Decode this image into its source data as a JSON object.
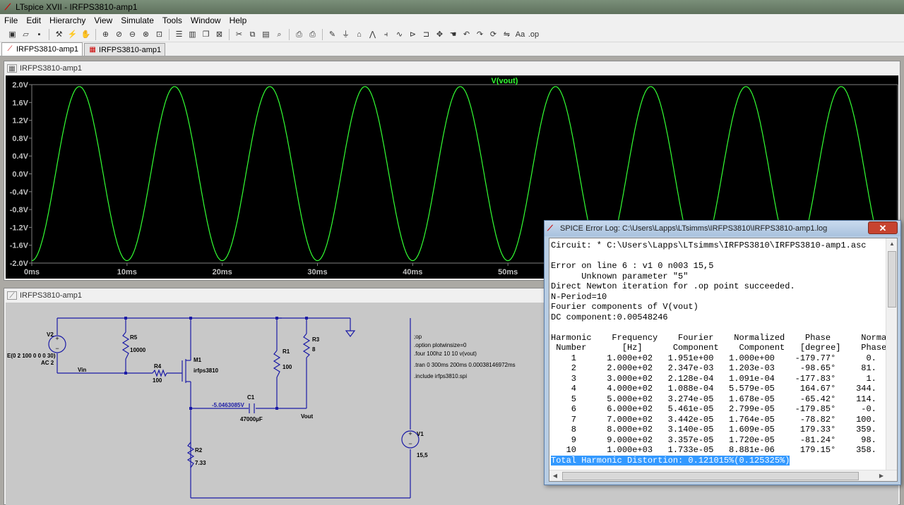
{
  "window": {
    "title": "LTspice XVII - IRFPS3810-amp1",
    "icon": "ltspice-logo-icon"
  },
  "menu": [
    "File",
    "Edit",
    "Hierarchy",
    "View",
    "Simulate",
    "Tools",
    "Window",
    "Help"
  ],
  "toolbar": {
    "icons": [
      "new-schematic-icon",
      "open-icon",
      "save-icon",
      "control-panel-icon",
      "run-icon",
      "halt-icon",
      "zoom-in-icon",
      "pan-icon",
      "zoom-out-icon",
      "zoom-full-icon",
      "autorange-icon",
      "tile-horizontal-icon",
      "tile-vertical-icon",
      "cascade-icon",
      "close-window-icon",
      "cut-icon",
      "copy-icon",
      "paste-icon",
      "find-icon",
      "print-setup-icon",
      "print-icon",
      "wire-icon",
      "ground-icon",
      "label-icon",
      "resistor-icon",
      "capacitor-icon",
      "inductor-icon",
      "diode-icon",
      "component-icon",
      "move-icon",
      "drag-icon",
      "undo-icon",
      "redo-icon",
      "rotate-icon",
      "mirror-icon",
      "text-icon",
      "spice-directive-icon"
    ]
  },
  "tabs": [
    {
      "label": "IRFPS3810-amp1",
      "icon": "schematic-icon",
      "active": true
    },
    {
      "label": "IRFPS3810-amp1",
      "icon": "waveform-icon",
      "active": false
    }
  ],
  "wave_pane": {
    "title": "IRFPS3810-amp1"
  },
  "chart_data": {
    "type": "line",
    "title": "V(vout)",
    "xlabel": "",
    "ylabel": "",
    "xlim": [
      0,
      91
    ],
    "ylim": [
      -2.0,
      2.0
    ],
    "x_ticks": [
      "0ms",
      "10ms",
      "20ms",
      "30ms",
      "40ms",
      "50ms"
    ],
    "x_tick_values": [
      0,
      10,
      20,
      30,
      40,
      50
    ],
    "y_ticks": [
      "2.0V",
      "1.6V",
      "1.2V",
      "0.8V",
      "0.4V",
      "0.0V",
      "-0.4V",
      "-0.8V",
      "-1.2V",
      "-1.6V",
      "-2.0V"
    ],
    "y_tick_values": [
      2.0,
      1.6,
      1.2,
      0.8,
      0.4,
      0.0,
      -0.4,
      -0.8,
      -1.2,
      -1.6,
      -2.0
    ],
    "series": [
      {
        "name": "V(vout)",
        "color": "#33ff33",
        "frequency_hz": 100,
        "amplitude": 1.951,
        "offset": 0.00548246,
        "phase_deg": -179.77
      }
    ],
    "grid": false,
    "background": "#000000"
  },
  "sch_pane": {
    "title": "IRFPS3810-amp1",
    "labels": {
      "v2": "V2",
      "v2_value1": "E(0 2 100 0 0 0 30)",
      "v2_value2": "AC 2",
      "r5": "R5",
      "r5_value": "10000",
      "vin": "Vin",
      "r4": "R4",
      "r4_value": "100",
      "m1": "M1",
      "m1_value": "irfps3810",
      "r1": "R1",
      "r1_value": "100",
      "r3": "R3",
      "r3_value": "8",
      "c1": "C1",
      "c1_value": "47000µF",
      "node_voltage": "-5.0463085V",
      "vout": "Vout",
      "r2": "R2",
      "r2_value": "7.33",
      "v1": "V1",
      "v1_value": "15,5",
      "dir_op": ";op",
      "dir_option": ".option plotwinsize=0",
      "dir_four": ".four 100hz 10 10 v(vout)",
      "dir_tran": ".tran 0 300ms 200ms 0.00038146972ms",
      "dir_include": ".include irfps3810.spi"
    }
  },
  "error_log": {
    "title": "SPICE Error Log: C:\\Users\\Lapps\\LTsimms\\IRFPS3810\\IRFPS3810-amp1.log",
    "close_label": "✕",
    "lines": [
      "Circuit: * C:\\Users\\Lapps\\LTsimms\\IRFPS3810\\IRFPS3810-amp1.asc",
      "",
      "Error on line 6 : v1 0 n003 15,5",
      "      Unknown parameter \"5\"",
      "Direct Newton iteration for .op point succeeded.",
      "N-Period=10",
      "Fourier components of V(vout)",
      "DC component:0.00548246",
      "",
      "Harmonic    Frequency    Fourier    Normalized    Phase      Normal",
      " Number       [Hz]      Component    Component   [degree]    Phase",
      "    1      1.000e+02   1.951e+00   1.000e+00    -179.77°      0.",
      "    2      2.000e+02   2.347e-03   1.203e-03     -98.65°     81.",
      "    3      3.000e+02   2.128e-04   1.091e-04    -177.83°      1.",
      "    4      4.000e+02   1.088e-04   5.579e-05     164.67°    344.",
      "    5      5.000e+02   3.274e-05   1.678e-05     -65.42°    114.",
      "    6      6.000e+02   5.461e-05   2.799e-05    -179.85°     -0.",
      "    7      7.000e+02   3.442e-05   1.764e-05     -78.82°    100.",
      "    8      8.000e+02   3.140e-05   1.609e-05     179.33°    359.",
      "    9      9.000e+02   3.357e-05   1.720e-05     -81.24°     98.",
      "   10      1.000e+03   1.733e-05   8.881e-06     179.15°    358."
    ],
    "thd_line": "Total Harmonic Distortion: 0.121015%(0.125325%)"
  }
}
